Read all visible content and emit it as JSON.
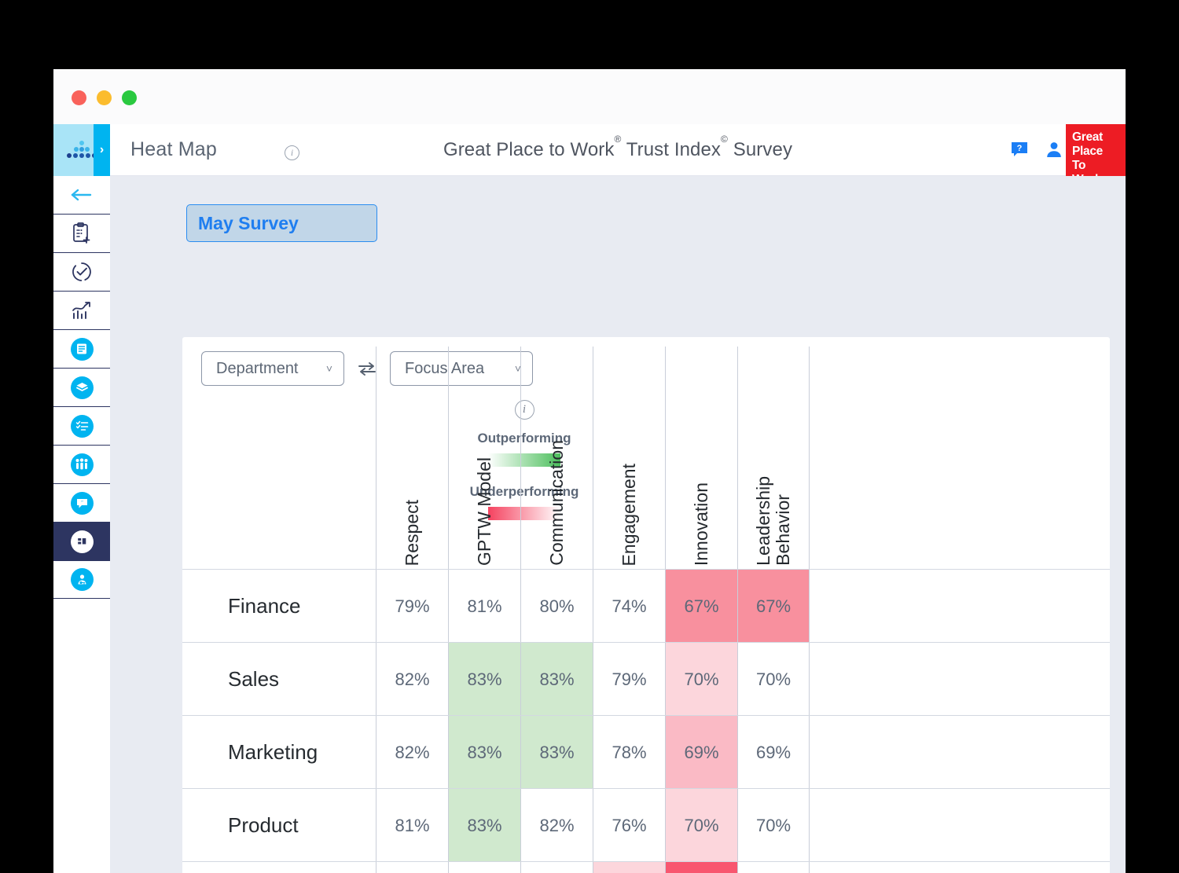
{
  "window": {
    "traffic_lights": [
      "close",
      "minimize",
      "maximize"
    ]
  },
  "sidebar": {
    "logo_name": "gptw-dots-logo",
    "expand_label": "›",
    "back_label": "←",
    "items": [
      {
        "name": "sidebar-item-new-survey",
        "icon": "clipboard-add-icon",
        "style": "outline"
      },
      {
        "name": "sidebar-item-survey-status",
        "icon": "circle-check-icon",
        "style": "outline"
      },
      {
        "name": "sidebar-item-analytics",
        "icon": "chart-trend-icon",
        "style": "outline"
      },
      {
        "name": "sidebar-item-reports",
        "icon": "document-icon",
        "style": "filled"
      },
      {
        "name": "sidebar-item-layers",
        "icon": "layers-icon",
        "style": "filled"
      },
      {
        "name": "sidebar-item-checklist",
        "icon": "checklist-icon",
        "style": "filled"
      },
      {
        "name": "sidebar-item-people",
        "icon": "people-group-icon",
        "style": "filled"
      },
      {
        "name": "sidebar-item-comments",
        "icon": "comment-quote-icon",
        "style": "filled"
      },
      {
        "name": "sidebar-item-heatmap",
        "icon": "heatmap-icon",
        "style": "filled",
        "active": true
      },
      {
        "name": "sidebar-item-account",
        "icon": "user-key-icon",
        "style": "filled"
      }
    ]
  },
  "header": {
    "page_title": "Heat Map",
    "page_title_info_icon": "info-icon",
    "survey_title_parts": {
      "a": "Great Place to Work",
      "sup1": "®",
      "b": " Trust Index",
      "sup2": "©",
      "c": " Survey"
    },
    "help_icon": "help-chat-icon",
    "user_icon": "user-avatar-icon",
    "logo": {
      "line1": "Great",
      "line2": "Place",
      "line3": "To",
      "line4": "Work",
      "registered": "®",
      "color": "#ed1c24"
    }
  },
  "content": {
    "survey_tab_label": "May Survey",
    "filters": {
      "left": {
        "label": "Department",
        "chevron": "˅"
      },
      "swap_icon": "swap-arrows-icon",
      "right": {
        "label": "Focus Area",
        "chevron": "˅"
      }
    },
    "legend": {
      "info_icon": "info-icon",
      "outperforming_label": "Outperforming",
      "underperforming_label": "Underperforming",
      "outperforming_color": "#4cbf5c",
      "underperforming_color": "#f5425f"
    }
  },
  "chart_data": {
    "type": "heatmap",
    "title": "Great Place to Work® Trust Index© Survey",
    "xlabel": "Focus Area",
    "ylabel": "Department",
    "categories": [
      "Respect",
      "GPTW Model",
      "Communication",
      "Engagement",
      "Innovation",
      "Leadership Behavior"
    ],
    "rows": [
      "Finance",
      "Sales",
      "Marketing",
      "Product"
    ],
    "unit": "%",
    "colorscale": {
      "outperforming": "#4cbf5c",
      "underperforming": "#f5425f",
      "neutral": "#ffffff"
    },
    "cells": [
      {
        "row": "Finance",
        "values": [
          {
            "label": "79%",
            "value": 79,
            "bg": "#ffffff"
          },
          {
            "label": "81%",
            "value": 81,
            "bg": "#ffffff"
          },
          {
            "label": "80%",
            "value": 80,
            "bg": "#ffffff"
          },
          {
            "label": "74%",
            "value": 74,
            "bg": "#ffffff"
          },
          {
            "label": "67%",
            "value": 67,
            "bg": "#f8909e"
          },
          {
            "label": "67%",
            "value": 67,
            "bg": "#f8909e"
          }
        ]
      },
      {
        "row": "Sales",
        "values": [
          {
            "label": "82%",
            "value": 82,
            "bg": "#ffffff"
          },
          {
            "label": "83%",
            "value": 83,
            "bg": "#d0e9ce"
          },
          {
            "label": "83%",
            "value": 83,
            "bg": "#d0e9ce"
          },
          {
            "label": "79%",
            "value": 79,
            "bg": "#ffffff"
          },
          {
            "label": "70%",
            "value": 70,
            "bg": "#fcd6dc"
          },
          {
            "label": "70%",
            "value": 70,
            "bg": "#ffffff"
          }
        ]
      },
      {
        "row": "Marketing",
        "values": [
          {
            "label": "82%",
            "value": 82,
            "bg": "#ffffff"
          },
          {
            "label": "83%",
            "value": 83,
            "bg": "#d0e9ce"
          },
          {
            "label": "83%",
            "value": 83,
            "bg": "#d0e9ce"
          },
          {
            "label": "78%",
            "value": 78,
            "bg": "#ffffff"
          },
          {
            "label": "69%",
            "value": 69,
            "bg": "#fabac5"
          },
          {
            "label": "69%",
            "value": 69,
            "bg": "#ffffff"
          }
        ]
      },
      {
        "row": "Product",
        "values": [
          {
            "label": "81%",
            "value": 81,
            "bg": "#ffffff"
          },
          {
            "label": "83%",
            "value": 83,
            "bg": "#d0e9ce"
          },
          {
            "label": "82%",
            "value": 82,
            "bg": "#ffffff"
          },
          {
            "label": "76%",
            "value": 76,
            "bg": "#ffffff"
          },
          {
            "label": "70%",
            "value": 70,
            "bg": "#fcd6dc"
          },
          {
            "label": "70%",
            "value": 70,
            "bg": "#ffffff"
          }
        ]
      }
    ],
    "partial_row_cells": [
      {
        "label": "",
        "bg": "#ffffff"
      },
      {
        "label": "",
        "bg": "#ffffff"
      },
      {
        "label": "",
        "bg": "#ffffff"
      },
      {
        "label": "",
        "bg": "#fcd6dc"
      },
      {
        "label": "",
        "bg": "#f8566f"
      },
      {
        "label": "",
        "bg": "#ffffff"
      }
    ]
  }
}
